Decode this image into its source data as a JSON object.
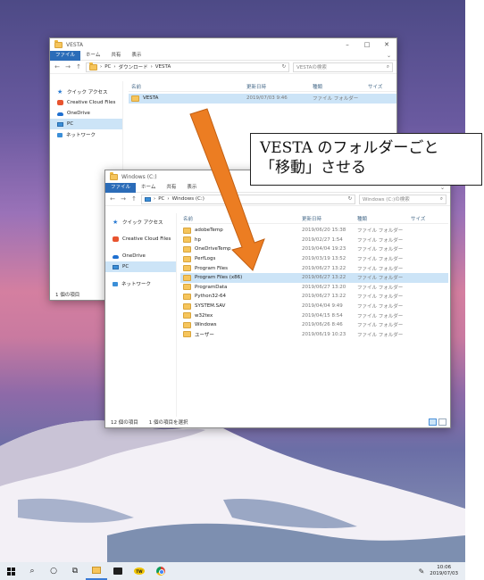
{
  "callout": {
    "line1": "VESTA のフォルダーごと",
    "line2": "「移動」させる"
  },
  "window_back": {
    "title": "VESTA",
    "ribbon": [
      "ファイル",
      "ホーム",
      "共有",
      "表示"
    ],
    "breadcrumb": [
      "PC",
      "ダウンロード",
      "VESTA"
    ],
    "search_placeholder": "VESTAの検索",
    "nav": [
      "クイック アクセス",
      "Creative Cloud Files",
      "OneDrive",
      "PC",
      "ネットワーク"
    ],
    "headers": [
      "名前",
      "更新日時",
      "種類",
      "サイズ"
    ],
    "rows": [
      {
        "name": "VESTA",
        "date": "2019/07/03 9:46",
        "type": "ファイル フォルダー"
      }
    ],
    "status": "1 個の項目"
  },
  "window_front": {
    "title": "Windows (C:)",
    "ribbon": [
      "ファイル",
      "ホーム",
      "共有",
      "表示"
    ],
    "breadcrumb": [
      "PC",
      "Windows (C:)"
    ],
    "search_placeholder": "Windows (C:)の検索",
    "nav": [
      "クイック アクセス",
      "Creative Cloud Files",
      "OneDrive",
      "PC",
      "ネットワーク"
    ],
    "headers": [
      "名前",
      "更新日時",
      "種類",
      "サイズ"
    ],
    "rows": [
      {
        "name": "adobeTemp",
        "date": "2019/06/20 15:38",
        "type": "ファイル フォルダー"
      },
      {
        "name": "hp",
        "date": "2019/02/27 1:54",
        "type": "ファイル フォルダー"
      },
      {
        "name": "OneDriveTemp",
        "date": "2019/04/04 19:23",
        "type": "ファイル フォルダー"
      },
      {
        "name": "PerfLogs",
        "date": "2019/03/19 13:52",
        "type": "ファイル フォルダー"
      },
      {
        "name": "Program Files",
        "date": "2019/06/27 13:22",
        "type": "ファイル フォルダー"
      },
      {
        "name": "Program Files (x86)",
        "date": "2019/06/27 13:22",
        "type": "ファイル フォルダー"
      },
      {
        "name": "ProgramData",
        "date": "2019/06/27 13:20",
        "type": "ファイル フォルダー"
      },
      {
        "name": "Python32-64",
        "date": "2019/06/27 13:22",
        "type": "ファイル フォルダー"
      },
      {
        "name": "SYSTEM.SAV",
        "date": "2019/04/04 9:49",
        "type": "ファイル フォルダー"
      },
      {
        "name": "w32tex",
        "date": "2019/04/15 8:54",
        "type": "ファイル フォルダー"
      },
      {
        "name": "Windows",
        "date": "2019/06/26 8:46",
        "type": "ファイル フォルダー"
      },
      {
        "name": "ユーザー",
        "date": "2019/06/19 10:23",
        "type": "ファイル フォルダー"
      }
    ],
    "selected_index": 5,
    "status_count": "12 個の項目",
    "status_selected": "1 個の項目を選択"
  },
  "taskbar": {
    "time": "10:06",
    "date": "2019/07/03",
    "tw_label": "TW"
  }
}
